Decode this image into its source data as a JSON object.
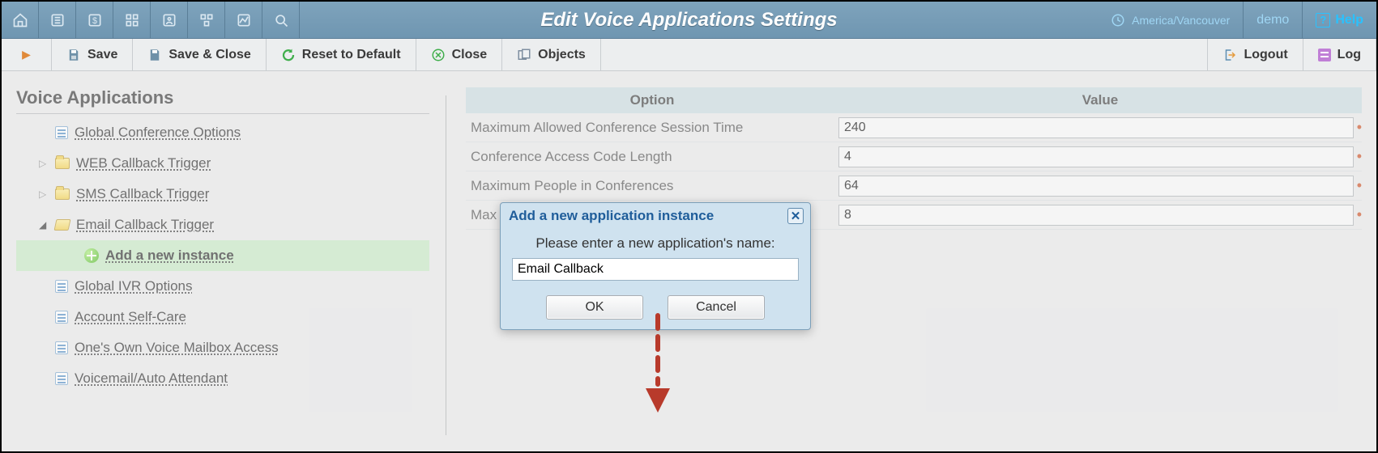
{
  "header": {
    "title": "Edit Voice Applications Settings",
    "timezone": "America/Vancouver",
    "user": "demo",
    "help_label": "Help"
  },
  "toolbar": {
    "save": "Save",
    "save_close": "Save & Close",
    "reset": "Reset to Default",
    "close": "Close",
    "objects": "Objects",
    "logout": "Logout",
    "log": "Log"
  },
  "sidebar": {
    "title": "Voice Applications",
    "items": [
      {
        "label": "Global Conference Options",
        "type": "doc"
      },
      {
        "label": "WEB Callback Trigger",
        "type": "folder-closed"
      },
      {
        "label": "SMS Callback Trigger",
        "type": "folder-closed"
      },
      {
        "label": "Email Callback Trigger",
        "type": "folder-open"
      },
      {
        "label": "Add a new instance",
        "type": "add"
      },
      {
        "label": "Global IVR Options",
        "type": "doc"
      },
      {
        "label": "Account Self-Care",
        "type": "doc"
      },
      {
        "label": "One's Own Voice Mailbox Access",
        "type": "doc"
      },
      {
        "label": "Voicemail/Auto Attendant",
        "type": "doc"
      }
    ]
  },
  "table": {
    "head_option": "Option",
    "head_value": "Value",
    "rows": [
      {
        "label": "Maximum Allowed Conference Session Time",
        "value": "240"
      },
      {
        "label": "Conference Access Code Length",
        "value": "4"
      },
      {
        "label": "Maximum People in Conferences",
        "value": "64"
      },
      {
        "label": "Max",
        "value": "8"
      }
    ]
  },
  "dialog": {
    "title": "Add a new application instance",
    "prompt": "Please enter a new application's name:",
    "value": "Email Callback",
    "ok": "OK",
    "cancel": "Cancel"
  }
}
